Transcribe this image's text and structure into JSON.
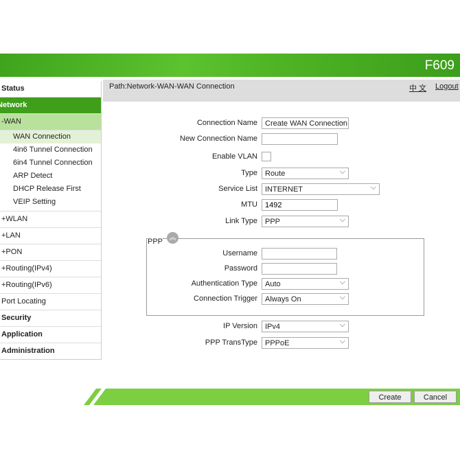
{
  "header": {
    "model": "F609"
  },
  "path": {
    "text": "Path:Network-WAN-WAN Connection",
    "lang": "中 文",
    "logout": "Logout"
  },
  "sidebar": {
    "status": "Status",
    "network": "Network",
    "wan": "-WAN",
    "wan_items": [
      "WAN Connection",
      "4in6 Tunnel Connection",
      "6in4 Tunnel Connection",
      "ARP Detect",
      "DHCP Release First",
      "VEIP Setting"
    ],
    "groups": [
      "+WLAN",
      "+LAN",
      "+PON",
      "+Routing(IPv4)",
      "+Routing(IPv6)"
    ],
    "port_locating": "Port Locating",
    "security": "Security",
    "application": "Application",
    "administration": "Administration"
  },
  "form": {
    "connection_name": {
      "label": "Connection Name",
      "value": "Create WAN Connection"
    },
    "new_connection_name": {
      "label": "New Connection Name",
      "value": ""
    },
    "enable_vlan": {
      "label": "Enable VLAN",
      "checked": false
    },
    "type": {
      "label": "Type",
      "value": "Route"
    },
    "service_list": {
      "label": "Service List",
      "value": "INTERNET"
    },
    "mtu": {
      "label": "MTU",
      "value": "1492"
    },
    "link_type": {
      "label": "Link Type",
      "value": "PPP"
    },
    "ppp": {
      "title": "PPP",
      "username": {
        "label": "Username",
        "value": ""
      },
      "password": {
        "label": "Password",
        "value": ""
      },
      "auth_type": {
        "label": "Authentication Type",
        "value": "Auto"
      },
      "trigger": {
        "label": "Connection Trigger",
        "value": "Always On"
      }
    },
    "ip_version": {
      "label": "IP Version",
      "value": "IPv4"
    },
    "ppp_transtype": {
      "label": "PPP TransType",
      "value": "PPPoE"
    }
  },
  "buttons": {
    "create": "Create",
    "cancel": "Cancel"
  },
  "colors": {
    "brand": "#4fb424",
    "footer": "#7ccf41"
  }
}
